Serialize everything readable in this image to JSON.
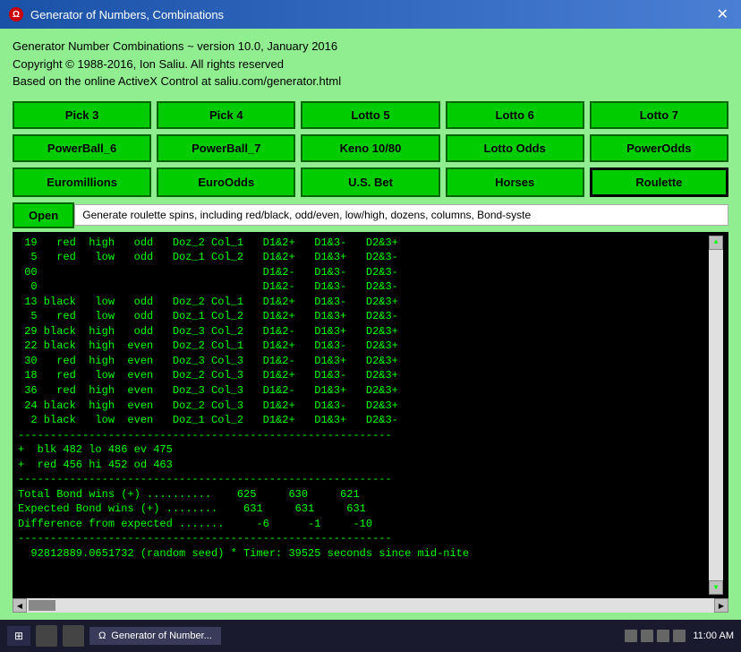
{
  "window": {
    "title": "Generator of Numbers, Combinations",
    "icon": "Ω"
  },
  "header": {
    "line1": "Generator Number Combinations ~ version 10.0, January 2016",
    "line2": "Copyright © 1988-2016, Ion Saliu. All rights reserved",
    "line3": "Based on the online ActiveX Control at saliu.com/generator.html"
  },
  "buttons": {
    "row1": [
      {
        "label": "Pick 3",
        "name": "pick3-button"
      },
      {
        "label": "Pick 4",
        "name": "pick4-button"
      },
      {
        "label": "Lotto 5",
        "name": "lotto5-button"
      },
      {
        "label": "Lotto 6",
        "name": "lotto6-button"
      },
      {
        "label": "Lotto 7",
        "name": "lotto7-button"
      }
    ],
    "row2": [
      {
        "label": "PowerBall_6",
        "name": "powerball6-button"
      },
      {
        "label": "PowerBall_7",
        "name": "powerball7-button"
      },
      {
        "label": "Keno 10/80",
        "name": "keno-button"
      },
      {
        "label": "Lotto Odds",
        "name": "lotto-odds-button"
      },
      {
        "label": "PowerOdds",
        "name": "powerodds-button"
      }
    ],
    "row3": [
      {
        "label": "Euromillions",
        "name": "euromillions-button"
      },
      {
        "label": "EuroOdds",
        "name": "euroodds-button"
      },
      {
        "label": "U.S. Bet",
        "name": "usbet-button"
      },
      {
        "label": "Horses",
        "name": "horses-button"
      },
      {
        "label": "Roulette",
        "name": "roulette-button",
        "outlined": true
      }
    ],
    "open": "Open",
    "open_desc": "Generate roulette spins, including red/black, odd/even, low/high, dozens, columns, Bond-syste"
  },
  "output": {
    "content": " 19   red  high   odd   Doz_2 Col_1   D1&2+   D1&3-   D2&3+\n  5   red   low   odd   Doz_1 Col_2   D1&2+   D1&3+   D2&3-\n 00                                   D1&2-   D1&3-   D2&3-\n  0                                   D1&2-   D1&3-   D2&3-\n 13 black   low   odd   Doz_2 Col_1   D1&2+   D1&3-   D2&3+\n  5   red   low   odd   Doz_1 Col_2   D1&2+   D1&3+   D2&3-\n 29 black  high   odd   Doz_3 Col_2   D1&2-   D1&3+   D2&3+\n 22 black  high  even   Doz_2 Col_1   D1&2+   D1&3-   D2&3+\n 30   red  high  even   Doz_3 Col_3   D1&2-   D1&3+   D2&3+\n 18   red   low  even   Doz_2 Col_3   D1&2+   D1&3-   D2&3+\n 36   red  high  even   Doz_3 Col_3   D1&2-   D1&3+   D2&3+\n 24 black  high  even   Doz_2 Col_3   D1&2+   D1&3-   D2&3+\n  2 black   low  even   Doz_1 Col_2   D1&2+   D1&3+   D2&3-\n----------------------------------------------------------\n+  blk 482 lo 486 ev 475\n+  red 456 hi 452 od 463\n----------------------------------------------------------\nTotal Bond wins (+) ..........    625     630     621\nExpected Bond wins (+) ........    631     631     631\nDifference from expected .......     -6      -1     -10\n----------------------------------------------------------\n  92812889.0651732 (random seed) * Timer: 39525 seconds since mid-nite"
  },
  "taskbar": {
    "app_label": "Generator of Number...",
    "time": "11:00 AM"
  }
}
